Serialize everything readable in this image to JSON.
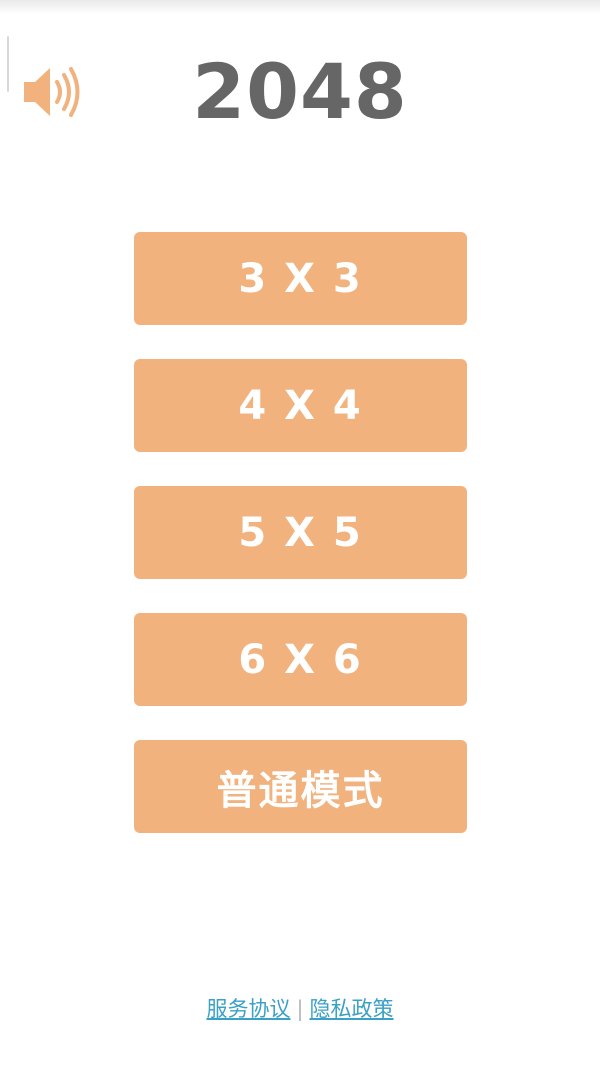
{
  "title": "2048",
  "sound_icon": "speaker-volume-icon",
  "modes": [
    {
      "label": "3 X 3"
    },
    {
      "label": "4 X 4"
    },
    {
      "label": "5 X 5"
    },
    {
      "label": "6 X 6"
    },
    {
      "label": "普通模式"
    }
  ],
  "footer": {
    "terms": "服务协议",
    "separator": "|",
    "privacy": "隐私政策"
  },
  "colors": {
    "accent": "#f1b27e",
    "title": "#666666",
    "link": "#3aa0c6"
  }
}
